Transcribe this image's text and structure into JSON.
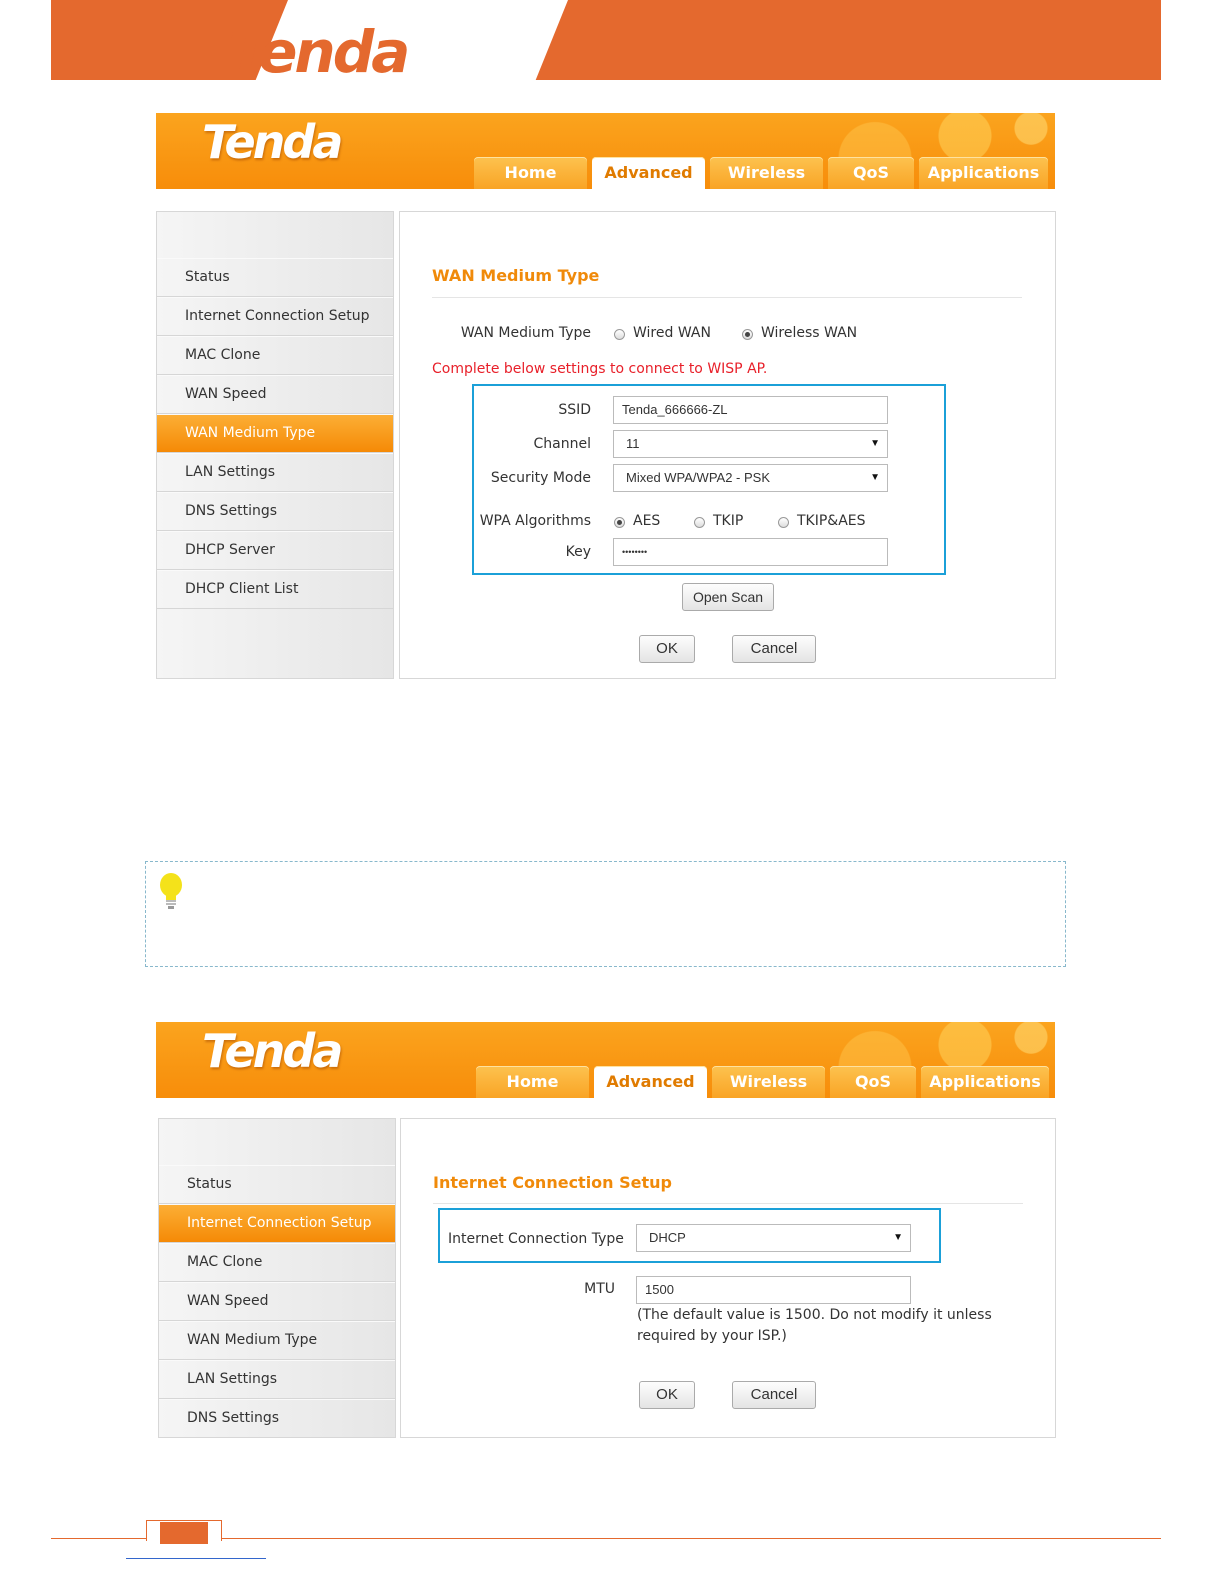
{
  "brand": {
    "logo": "Tenda"
  },
  "screen1": {
    "logo": "Tenda",
    "tabs": [
      "Home",
      "Advanced",
      "Wireless",
      "QoS",
      "Applications"
    ],
    "active_tab": "Advanced",
    "menu": [
      "Status",
      "Internet Connection Setup",
      "MAC Clone",
      "WAN Speed",
      "WAN Medium Type",
      "LAN Settings",
      "DNS Settings",
      "DHCP Server",
      "DHCP Client List"
    ],
    "active_menu": "WAN Medium Type",
    "section_title": "WAN Medium Type",
    "medium_label": "WAN Medium Type",
    "medium_options": [
      "Wired WAN",
      "Wireless WAN"
    ],
    "medium_selected": "Wireless WAN",
    "notice": "Complete below settings to connect to WISP AP.",
    "ssid_label": "SSID",
    "ssid_value": "Tenda_666666-ZL",
    "channel_label": "Channel",
    "channel_value": "11",
    "security_label": "Security Mode",
    "security_value": "Mixed WPA/WPA2 - PSK",
    "algo_label": "WPA Algorithms",
    "algo_options": [
      "AES",
      "TKIP",
      "TKIP&AES"
    ],
    "algo_selected": "AES",
    "key_label": "Key",
    "key_value": "••••••••",
    "scan_button": "Open Scan",
    "ok_button": "OK",
    "cancel_button": "Cancel"
  },
  "screen2": {
    "logo": "Tenda",
    "tabs": [
      "Home",
      "Advanced",
      "Wireless",
      "QoS",
      "Applications"
    ],
    "active_tab": "Advanced",
    "menu": [
      "Status",
      "Internet Connection Setup",
      "MAC Clone",
      "WAN Speed",
      "WAN Medium Type",
      "LAN Settings",
      "DNS Settings"
    ],
    "active_menu": "Internet Connection Setup",
    "section_title": "Internet Connection Setup",
    "type_label": "Internet Connection Type",
    "type_value": "DHCP",
    "mtu_label": "MTU",
    "mtu_value": "1500",
    "mtu_note_1": "(The default value is 1500. Do not modify it unless",
    "mtu_note_2": "required by your ISP.)",
    "ok_button": "OK",
    "cancel_button": "Cancel"
  },
  "colors": {
    "brand_orange": "#e4692e",
    "highlight_blue": "#1ba0d8",
    "notice_red": "#e8202a",
    "title_orange": "#f08a0a"
  }
}
